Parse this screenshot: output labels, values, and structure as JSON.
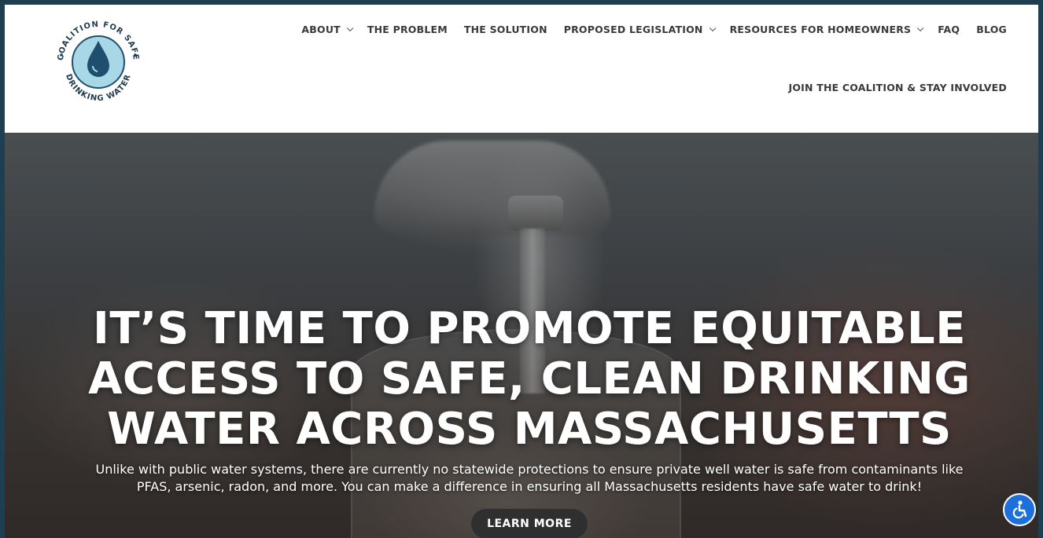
{
  "logo": {
    "text_top": "COALITION FOR SAFE",
    "text_bottom": "DRINKING WATER",
    "icon": "water-drop-icon",
    "colors": {
      "ring": "#a8d8e6",
      "drop": "#1f4f6e",
      "text": "#1f3b4d"
    }
  },
  "nav": {
    "items": [
      {
        "label": "ABOUT",
        "has_dropdown": true
      },
      {
        "label": "THE PROBLEM",
        "has_dropdown": false
      },
      {
        "label": "THE SOLUTION",
        "has_dropdown": false
      },
      {
        "label": "PROPOSED LEGISLATION",
        "has_dropdown": true
      },
      {
        "label": "RESOURCES FOR HOMEOWNERS",
        "has_dropdown": true
      },
      {
        "label": "FAQ",
        "has_dropdown": false
      },
      {
        "label": "BLOG",
        "has_dropdown": false
      }
    ],
    "secondary": "JOIN THE COALITION & STAY INVOLVED"
  },
  "hero": {
    "title_lines": [
      "IT’S TIME TO PROMOTE EQUITABLE",
      "ACCESS TO SAFE, CLEAN DRINKING",
      "WATER ACROSS MASSACHUSETTS"
    ],
    "subtitle_lines": [
      "Unlike with public water systems, there are currently no statewide protections to ensure private well water is safe from contaminants like",
      "PFAS, arsenic, radon, and more. You can make a difference in ensuring all Massachusetts residents have safe water to drink!"
    ],
    "button_label": "LEARN MORE"
  },
  "accessibility": {
    "icon": "accessibility-icon",
    "color": "#1d6fdc"
  }
}
